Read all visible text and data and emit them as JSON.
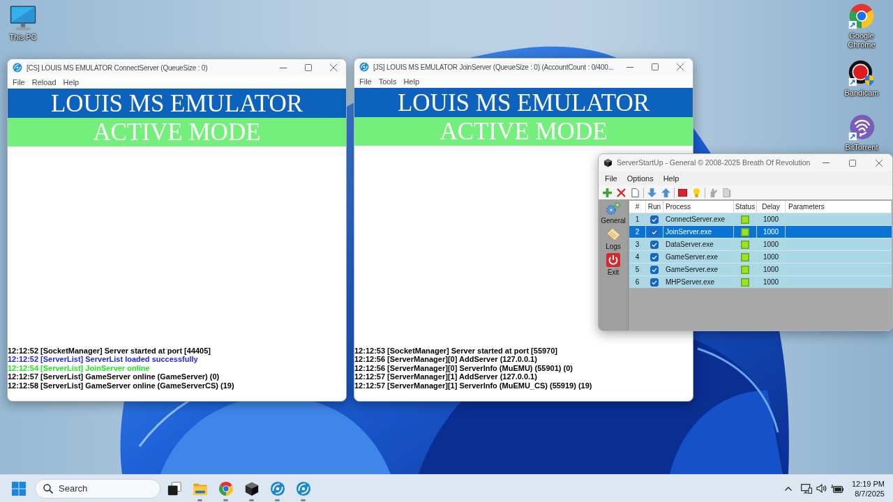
{
  "desktop_icons": [
    {
      "label": "This PC",
      "kind": "monitor"
    },
    {
      "label": "Google Chrome",
      "kind": "browser"
    },
    {
      "label": "Bandicam",
      "kind": "recorder"
    },
    {
      "label": "BitTorrent",
      "kind": "torrent"
    }
  ],
  "connect_server": {
    "title": "[CS] LOUIS MS EMULATOR ConnectServer (QueueSize : 0)",
    "menu": [
      "File",
      "Reload",
      "Help"
    ],
    "banner": "LOUIS MS EMULATOR",
    "mode": "ACTIVE MODE",
    "log": [
      {
        "text": "12:12:52 [SocketManager] Server started at port [44405]",
        "color": "#000000"
      },
      {
        "text": "12:12:52 [ServerList] ServerList loaded successfully",
        "color": "#1e1eff"
      },
      {
        "text": "12:12:54 [ServerList] JoinServer online",
        "color": "#1ee61e"
      },
      {
        "text": "12:12:57 [ServerList] GameServer online (GameServer) (0)",
        "color": "#000000"
      },
      {
        "text": "12:12:58 [ServerList] GameServer online (GameServerCS) (19)",
        "color": "#000000"
      }
    ]
  },
  "join_server": {
    "title": "[JS] LOUIS MS EMULATOR JoinServer (QueueSize : 0) (AccountCount : 0/400...",
    "menu": [
      "File",
      "Tools",
      "Help"
    ],
    "banner": "LOUIS MS EMULATOR",
    "mode": "ACTIVE MODE",
    "log": [
      {
        "text": "12:12:53 [SocketManager] Server started at port [55970]",
        "color": "#000000"
      },
      {
        "text": "12:12:56 [ServerManager][0] AddServer (127.0.0.1)",
        "color": "#000000"
      },
      {
        "text": "12:12:56 [ServerManager][0] ServerInfo (MuEMU) (55901) (0)",
        "color": "#000000"
      },
      {
        "text": "12:12:57 [ServerManager][1] AddServer (127.0.0.1)",
        "color": "#000000"
      },
      {
        "text": "12:12:57 [ServerManager][1] ServerInfo (MuEMU_CS) (55919) (19)",
        "color": "#000000"
      }
    ]
  },
  "server_startup": {
    "title": "ServerStartUp - General © 2008-2025 Breath Of Revolution",
    "menu": [
      "File",
      "Options",
      "Help"
    ],
    "toolbar": [
      [
        {
          "kind": "add",
          "disabled": false
        },
        {
          "kind": "delete",
          "disabled": false
        },
        {
          "kind": "new",
          "disabled": false
        }
      ],
      [
        {
          "kind": "down",
          "disabled": false
        },
        {
          "kind": "up",
          "disabled": false
        }
      ],
      [
        {
          "kind": "stop",
          "disabled": false
        },
        {
          "kind": "bulb",
          "disabled": false
        }
      ],
      [
        {
          "kind": "hand",
          "disabled": true
        },
        {
          "kind": "copy",
          "disabled": true
        }
      ]
    ],
    "sidebar": [
      {
        "label": "General",
        "kind": "gears"
      },
      {
        "label": "Logs",
        "kind": "note"
      },
      {
        "label": "Exit",
        "kind": "power"
      }
    ],
    "table": {
      "columns": [
        "#",
        "Run",
        "Process",
        "Status",
        "Delay",
        "Parameters"
      ],
      "rows": [
        {
          "number": "1",
          "run": true,
          "process": "ConnectServer.exe",
          "running": true,
          "delay": "1000",
          "selected": false
        },
        {
          "number": "2",
          "run": true,
          "process": "JoinServer.exe",
          "running": true,
          "delay": "1000",
          "selected": true
        },
        {
          "number": "3",
          "run": true,
          "process": "DataServer.exe",
          "running": true,
          "delay": "1000",
          "selected": false
        },
        {
          "number": "4",
          "run": true,
          "process": "GameServer.exe",
          "running": true,
          "delay": "1000",
          "selected": false
        },
        {
          "number": "5",
          "run": true,
          "process": "GameServer.exe",
          "running": true,
          "delay": "1000",
          "selected": false
        },
        {
          "number": "6",
          "run": true,
          "process": "MHPServer.exe",
          "running": true,
          "delay": "1000",
          "selected": false
        }
      ]
    }
  },
  "taskbar": {
    "search": {
      "placeholder": "Search"
    },
    "apps": [
      {
        "kind": "taskview",
        "running": false
      },
      {
        "kind": "folder",
        "running": true
      },
      {
        "kind": "browser",
        "running": true
      },
      {
        "kind": "cube",
        "running": true
      },
      {
        "kind": "globe",
        "running": true
      },
      {
        "kind": "globe",
        "running": true
      }
    ],
    "time": "12:19 PM",
    "date": "8/7/2025"
  }
}
